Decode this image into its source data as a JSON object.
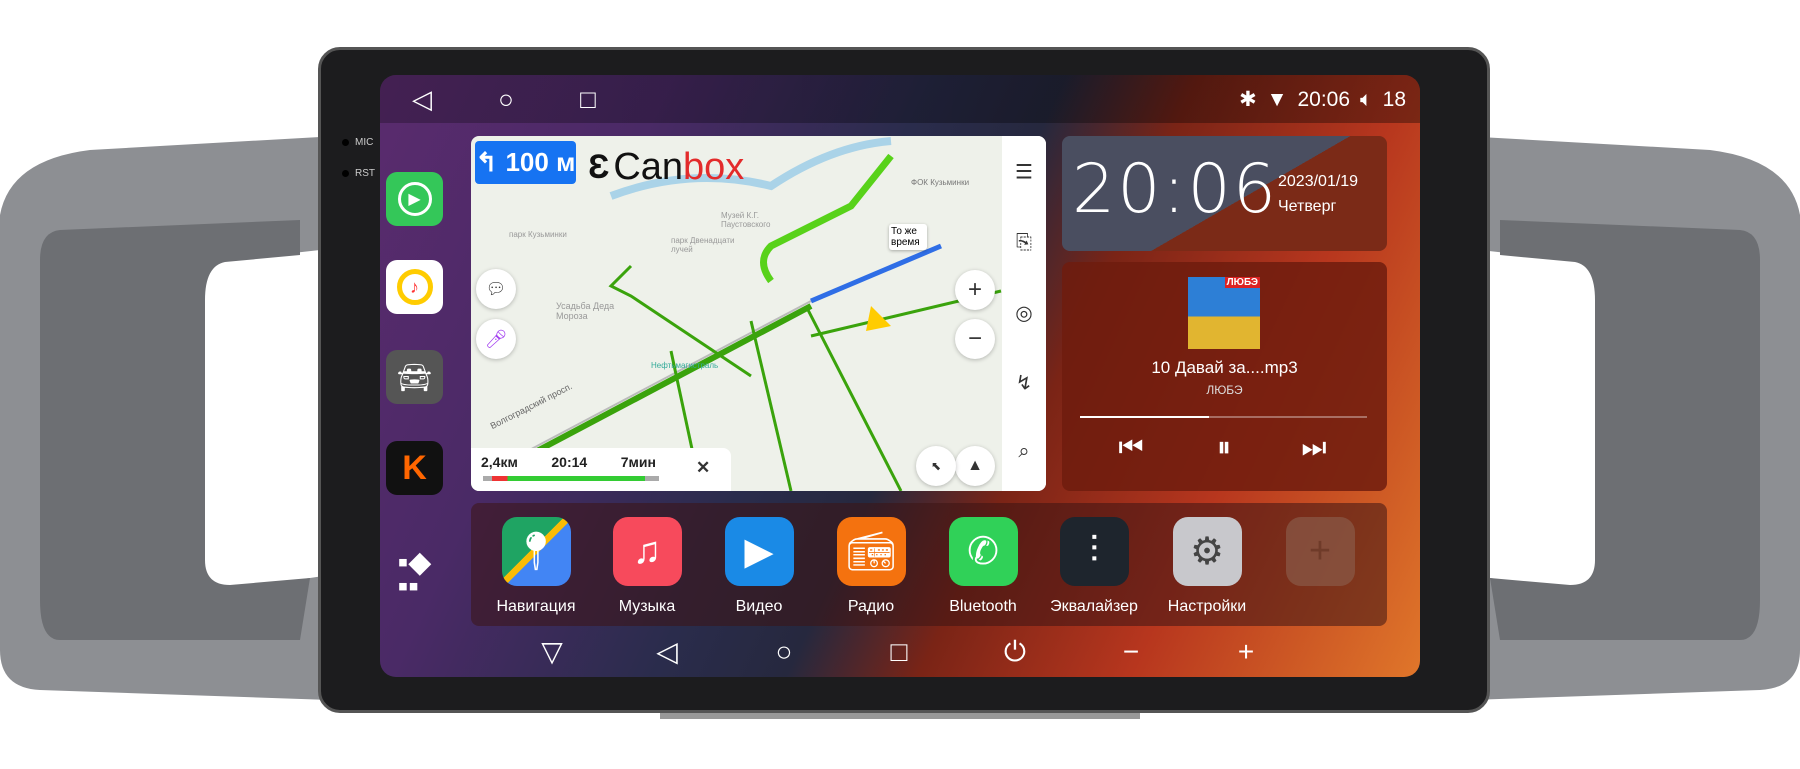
{
  "hardware": {
    "mic_label": "MIC",
    "rst_label": "RST"
  },
  "statusbar": {
    "time": "20:06",
    "volume": "18",
    "icons": [
      "bluetooth-icon",
      "wifi-icon",
      "volume-icon"
    ]
  },
  "top_nav": [
    "back-icon",
    "home-icon",
    "recents-icon"
  ],
  "sidebar": {
    "apps": [
      {
        "name": "carplay",
        "color": "#34c759"
      },
      {
        "name": "yandex-music",
        "color": "#ffcc00"
      },
      {
        "name": "car-info",
        "color": "#444"
      },
      {
        "name": "kinopoisk",
        "color": "#ff6600"
      },
      {
        "name": "all-apps"
      }
    ]
  },
  "map": {
    "turn_distance": "100 м",
    "logo_left": "Can",
    "logo_right": "box",
    "tooltip": "То же время",
    "street": "Волгоградский просп.",
    "places": [
      "парк Кузьминки",
      "Музей К.Г. Паустовского",
      "парк Двенадцати лучей",
      "Усадьба Деда Мороза",
      "ФОК Кузьминки",
      "Нефтьмагистраль"
    ],
    "eta": {
      "distance": "2,4км",
      "arrival": "20:14",
      "duration": "7мин",
      "close": "✕"
    }
  },
  "clock": {
    "time": "20:06",
    "date": "2023/01/19",
    "weekday": "Четверг"
  },
  "music": {
    "title": "10 Давай за....mp3",
    "artist": "ЛЮБЭ",
    "album_label": "ЛЮБЭ",
    "progress": 0.45
  },
  "dock": [
    {
      "label": "Навигация",
      "icon": "maps-icon",
      "color": "#1fa463"
    },
    {
      "label": "Музыка",
      "icon": "music-icon",
      "color": "#f74a5c"
    },
    {
      "label": "Видео",
      "icon": "video-icon",
      "color": "#1a8ae6"
    },
    {
      "label": "Радио",
      "icon": "radio-icon",
      "color": "#f4720f"
    },
    {
      "label": "Bluetooth",
      "icon": "phone-icon",
      "color": "#30d158"
    },
    {
      "label": "Эквалайзер",
      "icon": "equalizer-icon",
      "color": "#1e252d"
    },
    {
      "label": "Настройки",
      "icon": "settings-icon",
      "color": "#c8c8cc"
    },
    {
      "label": "",
      "icon": "add-icon",
      "color": "#8a5a48"
    }
  ],
  "bottom_nav": [
    "down-icon",
    "back-icon",
    "home-icon",
    "recents-icon",
    "power-icon",
    "volume-down-icon",
    "volume-up-icon"
  ]
}
